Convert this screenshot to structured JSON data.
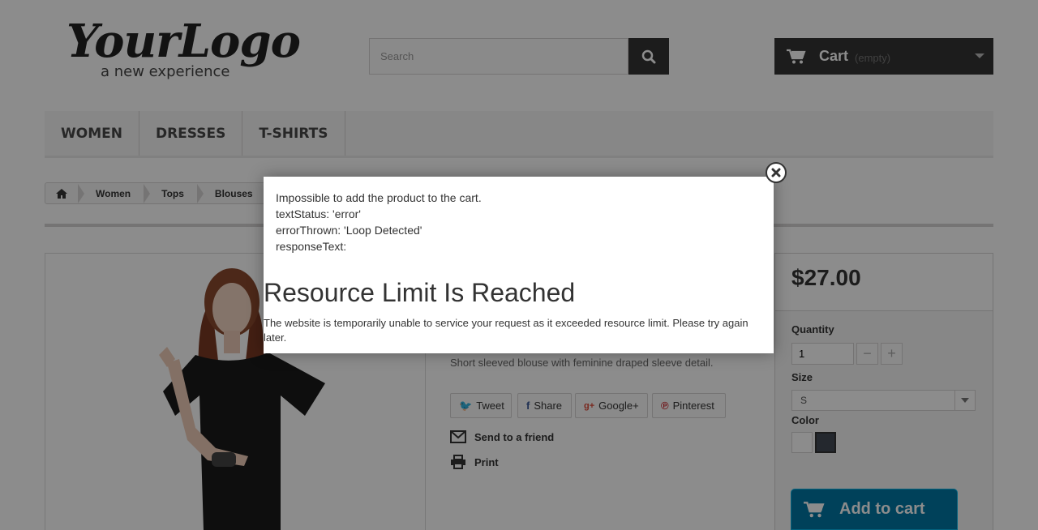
{
  "header": {
    "logo": {
      "main": "YourLogo",
      "tagline": "a new experience"
    },
    "search": {
      "placeholder": "Search"
    },
    "cart": {
      "label": "Cart",
      "status": "(empty)"
    }
  },
  "menu": {
    "items": [
      "Women",
      "Dresses",
      "T-shirts"
    ]
  },
  "breadcrumb": {
    "items": [
      "Women",
      "Tops",
      "Blouses"
    ]
  },
  "product": {
    "description": "Short sleeved blouse with feminine draped sleeve detail.",
    "social": {
      "tweet": "Tweet",
      "share": "Share",
      "google": "Google+",
      "pinterest": "Pinterest"
    },
    "actions": {
      "send": "Send to a friend",
      "print": "Print"
    },
    "price": "$27.00",
    "quantity_label": "Quantity",
    "quantity_value": "1",
    "size_label": "Size",
    "size_value": "S",
    "color_label": "Color",
    "colors": [
      "#ffffff",
      "#434a54"
    ],
    "add_to_cart": "Add to cart"
  },
  "modal": {
    "lines": [
      "Impossible to add the product to the cart.",
      "textStatus: 'error'",
      "errorThrown: 'Loop Detected'",
      "responseText:"
    ],
    "error_title": "Resource Limit Is Reached",
    "error_body": "The website is temporarily unable to service your request as it exceeded resource limit. Please try again later."
  }
}
